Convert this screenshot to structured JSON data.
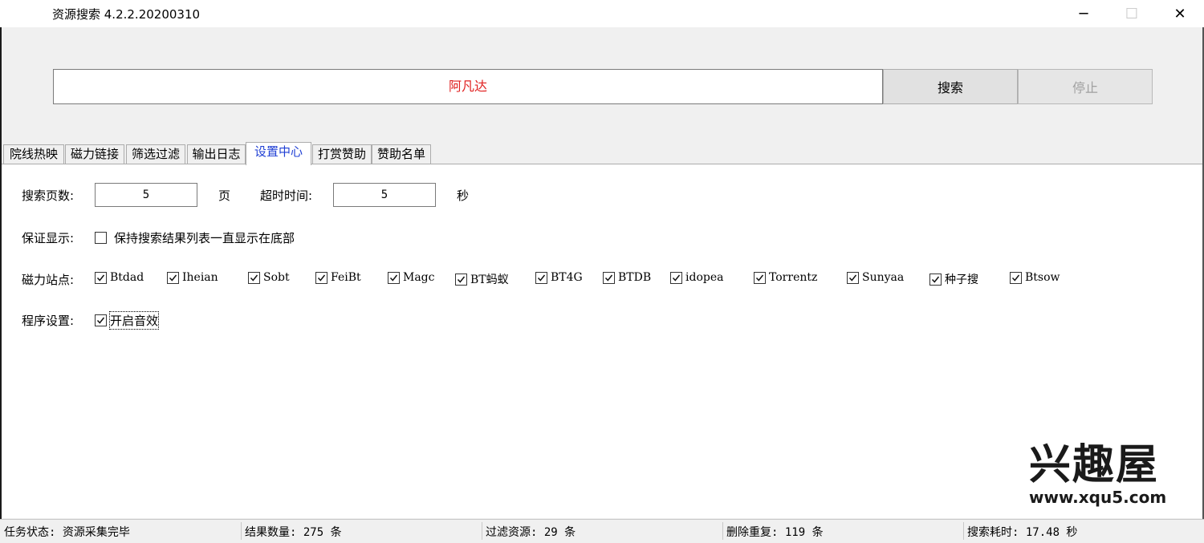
{
  "window": {
    "title": "资源搜索 4.2.2.20200310",
    "minimize_glyph": "─",
    "maximize_glyph": "☐",
    "close_glyph": "✕"
  },
  "search": {
    "query": "阿凡达",
    "query_color": "#e02020",
    "search_label": "搜索",
    "stop_label": "停止"
  },
  "tabs": [
    "院线热映",
    "磁力链接",
    "筛选过滤",
    "输出日志",
    "设置中心",
    "打赏赞助",
    "赞助名单"
  ],
  "active_tab": "设置中心",
  "settings": {
    "pages_label": "搜索页数:",
    "pages_value": "5",
    "pages_unit": "页",
    "timeout_label": "超时时间:",
    "timeout_value": "5",
    "timeout_unit": "秒",
    "display_label": "保证显示:",
    "display_option": "保持搜索结果列表一直显示在底部",
    "display_checked": false,
    "sites_label": "磁力站点:",
    "sites": [
      {
        "name": "Btdad",
        "checked": true
      },
      {
        "name": "Iheian",
        "checked": true
      },
      {
        "name": "Sobt",
        "checked": true
      },
      {
        "name": "FeiBt",
        "checked": true
      },
      {
        "name": "Magc",
        "checked": true
      },
      {
        "name": "BT蚂蚁",
        "checked": true
      },
      {
        "name": "BT4G",
        "checked": true
      },
      {
        "name": "BTDB",
        "checked": true
      },
      {
        "name": "idopea",
        "checked": true
      },
      {
        "name": "Torrentz",
        "checked": true
      },
      {
        "name": "Sunyaa",
        "checked": true
      },
      {
        "name": "种子搜",
        "checked": true
      },
      {
        "name": "Btsow",
        "checked": true
      }
    ],
    "program_label": "程序设置:",
    "program_option": "开启音效",
    "program_checked": true
  },
  "watermark": {
    "logo": "兴趣屋",
    "url": "www.xqu5.com"
  },
  "status": {
    "task": "任务状态: 资源采集完毕",
    "results": "结果数量: 275 条",
    "filtered": "过滤资源: 29 条",
    "duplicates": "删除重复: 119 条",
    "elapsed": "搜索耗时: 17.48 秒"
  }
}
